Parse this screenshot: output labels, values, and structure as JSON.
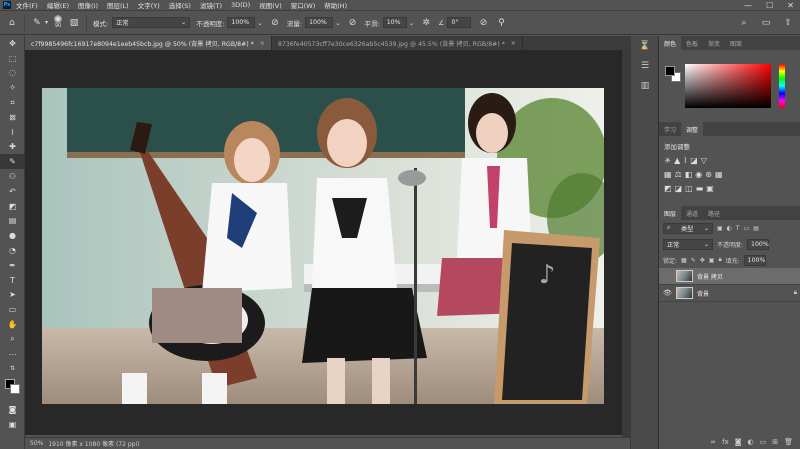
{
  "menu": [
    "文件(F)",
    "编辑(E)",
    "图像(I)",
    "图层(L)",
    "文字(Y)",
    "选择(S)",
    "滤镜(T)",
    "3D(D)",
    "视图(V)",
    "窗口(W)",
    "帮助(H)"
  ],
  "app_icon": "Ps",
  "options": {
    "brush_size": "90",
    "mode_label": "模式:",
    "mode_value": "正常",
    "opacity_label": "不透明度:",
    "opacity_value": "100%",
    "flow_label": "流量:",
    "flow_value": "100%",
    "smooth_label": "平滑:",
    "smooth_value": "10%",
    "angle_value": "0°"
  },
  "tabs": [
    {
      "label": "c7f9985496fc16917e8094e1eeb45bcb.jpg @ 50% (背景 拷贝, RGB/8#) *",
      "close": "×"
    },
    {
      "label": "8736fe40573cff7e30ce6326ab5c4539.jpg @ 45.5% (背景 拷贝, RGB/8#) *",
      "close": "×"
    }
  ],
  "status": {
    "zoom": "50%",
    "doc_info": "1910 像素 x 1080 像素 (72 ppi)"
  },
  "panels": {
    "color_tabs": [
      "颜色",
      "色板",
      "渐变",
      "图案"
    ],
    "adjust_tabs": [
      "学习",
      "调整"
    ],
    "adjust_title": "添加调整",
    "layers_tabs": [
      "图层",
      "通道",
      "路径"
    ],
    "kind_value": "类型",
    "blend_value": "正常",
    "opacity_label": "不透明度:",
    "opacity_value": "100%",
    "lock_label": "锁定:",
    "fill_label": "填充:",
    "fill_value": "100%",
    "layers": [
      {
        "name": "背景 拷贝",
        "selected": true
      },
      {
        "name": "背景",
        "selected": false
      }
    ]
  },
  "colors": {
    "bg": "#535353",
    "canvas": "#282828",
    "accent": "#31a8ff"
  }
}
